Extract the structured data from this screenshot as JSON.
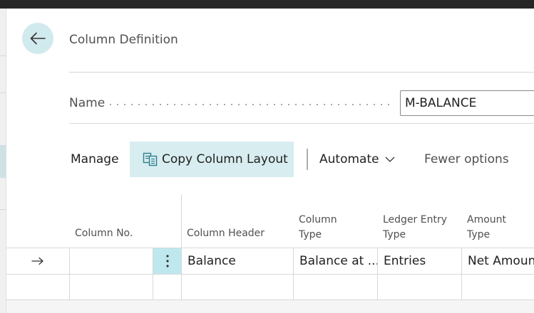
{
  "page": {
    "title": "Column Definition"
  },
  "name_field": {
    "label": "Name",
    "value": "M-BALANCE"
  },
  "actions": {
    "manage": "Manage",
    "copy_column_layout": "Copy Column Layout",
    "automate": "Automate",
    "fewer_options": "Fewer options"
  },
  "icons": {
    "back": "back-arrow-icon",
    "copy": "copy-documents-icon",
    "automate_chevron": "chevron-down-icon",
    "row_pointer": "right-arrow-icon",
    "row_menu": "vertical-ellipsis-icon"
  },
  "grid": {
    "columns": {
      "column_no": "Column No.",
      "column_header": "Column Header",
      "column_type": "Column Type",
      "ledger_entry_type": "Ledger Entry Type",
      "amount_type": "Amount Type"
    },
    "column_type_line1": "Column",
    "column_type_line2": "Type",
    "ledger_entry_type_line1": "Ledger Entry",
    "ledger_entry_type_line2": "Type",
    "amount_type_line1": "Amount",
    "amount_type_line2": "Type",
    "rows": [
      {
        "column_no": "",
        "column_header": "Balance",
        "column_type": "Balance at ...",
        "ledger_entry_type": "Entries",
        "amount_type": "Net Amount"
      },
      {
        "column_no": "",
        "column_header": "",
        "column_type": "",
        "ledger_entry_type": "",
        "amount_type": ""
      }
    ]
  },
  "colors": {
    "accent_light": "#d1eaee",
    "row_menu_active": "#bfe8ee",
    "icon_teal": "#2b7f8c"
  }
}
